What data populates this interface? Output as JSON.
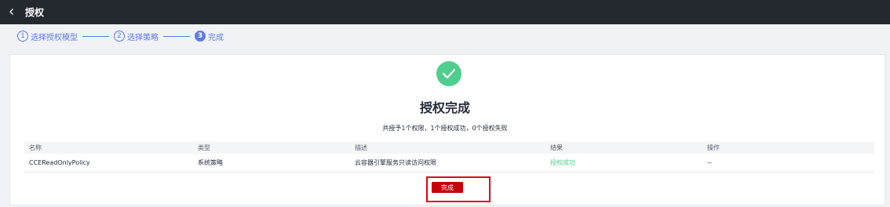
{
  "header": {
    "title": "授权",
    "back_icon": "chevron-left-icon"
  },
  "steps": [
    {
      "num": "1",
      "label": "选择授权模型"
    },
    {
      "num": "2",
      "label": "选择策略"
    },
    {
      "num": "3",
      "label": "完成"
    }
  ],
  "result": {
    "icon": "check-circle-icon",
    "title": "授权完成",
    "summary": "共授予1个权限，1个授权成功，0个授权失败"
  },
  "table": {
    "headers": {
      "name": "名称",
      "type": "类型",
      "desc": "描述",
      "result": "结果",
      "action": "操作"
    },
    "rows": [
      {
        "name": "CCEReadOnlyPolicy",
        "type": "系统策略",
        "desc": "云容器引擎服务只读访问权限",
        "result": "授权成功",
        "action": "--"
      }
    ]
  },
  "footer": {
    "done_label": "完成"
  },
  "colors": {
    "accent": "#5e7ce0",
    "success": "#4fcf8d",
    "primary_button": "#c7000b",
    "highlight": "#e0000f",
    "topbar": "#23292f"
  }
}
